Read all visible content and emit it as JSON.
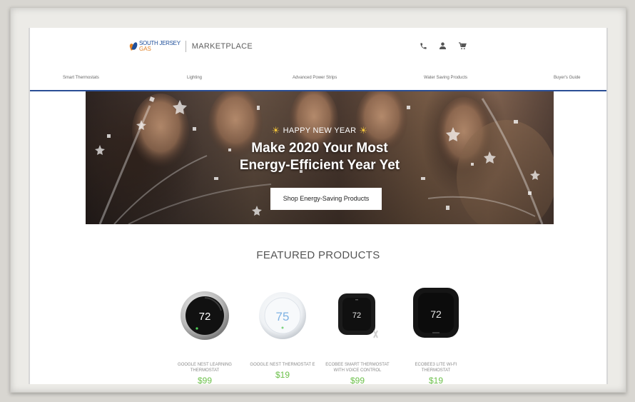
{
  "header": {
    "logo_line1": "SOUTH JERSEY",
    "logo_line2": "GAS",
    "marketplace": "MARKETPLACE",
    "icons": [
      "phone-icon",
      "account-icon",
      "cart-icon"
    ]
  },
  "nav": {
    "items": [
      {
        "label": "Smart Thermostats"
      },
      {
        "label": "Lighting"
      },
      {
        "label": "Advanced Power Strips"
      },
      {
        "label": "Water Saving Products"
      },
      {
        "label": "Buyer's Guide"
      }
    ]
  },
  "hero": {
    "eyebrow": "HAPPY NEW YEAR",
    "headline_line1": "Make 2020 Your Most",
    "headline_line2": "Energy-Efficient Year Yet",
    "cta": "Shop Energy-Saving Products"
  },
  "featured": {
    "title": "FEATURED PRODUCTS",
    "products": [
      {
        "name_line1": "GOOGLE NEST LEARNING",
        "name_line2": "THERMOSTAT",
        "price": "$99",
        "display": "72"
      },
      {
        "name_line1": "GOOGLE NEST THERMOSTAT E",
        "name_line2": "",
        "price": "$19",
        "display": "75"
      },
      {
        "name_line1": "ECOBEE SMART THERMOSTAT",
        "name_line2": "WITH VOICE CONTROL",
        "price": "$99",
        "display": "72"
      },
      {
        "name_line1": "ECOBEE3 LITE WI-FI",
        "name_line2": "THERMOSTAT",
        "price": "$19",
        "display": "72"
      }
    ]
  },
  "colors": {
    "brand_blue": "#1f4f9a",
    "brand_orange": "#e07f22",
    "nav_rule": "#2a4e95",
    "price_green": "#6cc04a"
  }
}
